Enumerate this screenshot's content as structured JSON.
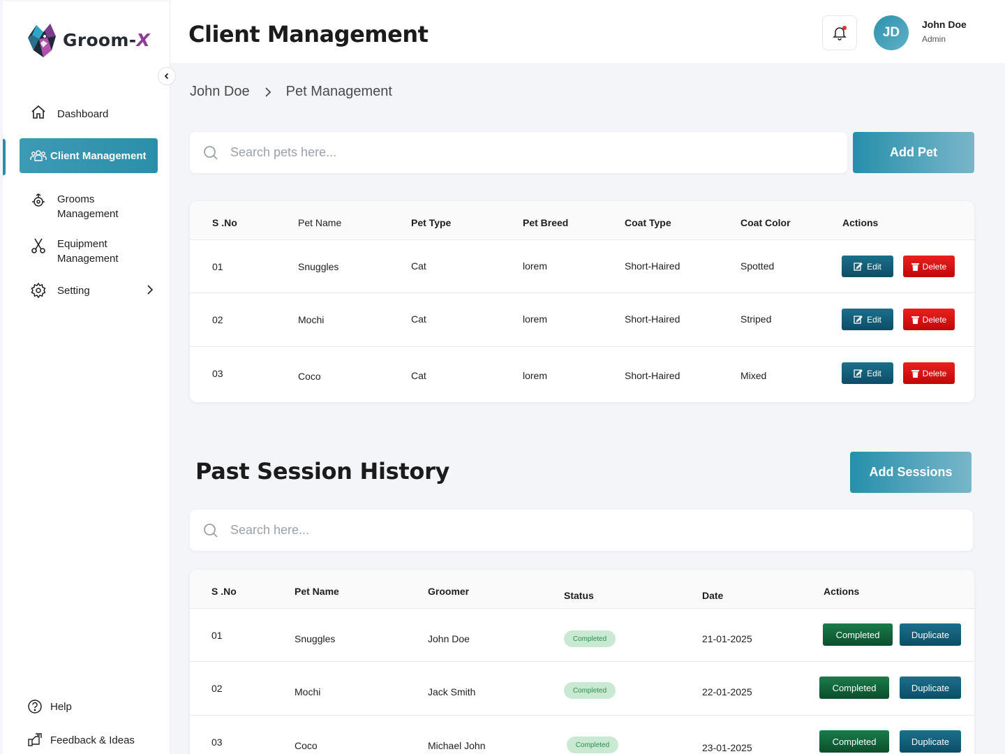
{
  "brand": {
    "name_main": "Groom-",
    "name_accent": "X"
  },
  "sidebar": {
    "items": [
      {
        "label": "Dashboard"
      },
      {
        "label": "Client Management"
      },
      {
        "label_line1": "Grooms",
        "label_line2": "Management"
      },
      {
        "label_line1": "Equipment",
        "label_line2": "Management"
      },
      {
        "label": "Setting"
      }
    ],
    "bottom": [
      {
        "label": "Help"
      },
      {
        "label": "Feedback & Ideas"
      }
    ]
  },
  "header": {
    "title": "Client Management",
    "user": {
      "initials": "JD",
      "name": "John Doe",
      "role": "Admin"
    }
  },
  "breadcrumb": {
    "parent": "John Doe",
    "current": "Pet Management"
  },
  "pets": {
    "search_placeholder": "Search pets here...",
    "add_label": "Add Pet",
    "columns": [
      "S .No",
      "Pet Name",
      "Pet Type",
      "Pet Breed",
      "Coat Type",
      "Coat Color",
      "Actions"
    ],
    "rows": [
      {
        "sno": "01",
        "name": "Snuggles",
        "type": "Cat",
        "breed": "lorem",
        "coat_type": "Short-Haired",
        "coat_color": "Spotted"
      },
      {
        "sno": "02",
        "name": "Mochi",
        "type": "Cat",
        "breed": "lorem",
        "coat_type": "Short-Haired",
        "coat_color": "Striped"
      },
      {
        "sno": "03",
        "name": "Coco",
        "type": "Cat",
        "breed": "lorem",
        "coat_type": "Short-Haired",
        "coat_color": "Mixed"
      }
    ],
    "edit_label": "Edit",
    "delete_label": "Delete"
  },
  "sessions": {
    "title": "Past Session History",
    "add_label": "Add Sessions",
    "search_placeholder": "Search here...",
    "columns": [
      "S .No",
      "Pet Name",
      "Groomer",
      "Status",
      "Date",
      "Actions"
    ],
    "rows": [
      {
        "sno": "01",
        "name": "Snuggles",
        "groomer": "John Doe",
        "status": "Completed",
        "date": "21-01-2025"
      },
      {
        "sno": "02",
        "name": "Mochi",
        "groomer": "Jack Smith",
        "status": "Completed",
        "date": "22-01-2025"
      },
      {
        "sno": "03",
        "name": "Coco",
        "groomer": "Michael John",
        "status": "Completed",
        "date": "23-01-2025"
      }
    ],
    "complete_label": "Completed",
    "duplicate_label": "Duplicate"
  },
  "colors": {
    "accent": "#2a8ea8",
    "danger": "#d81212",
    "success": "#0f5e36",
    "dark_teal": "#0f4f68",
    "brand_purple": "#8e3d97"
  }
}
